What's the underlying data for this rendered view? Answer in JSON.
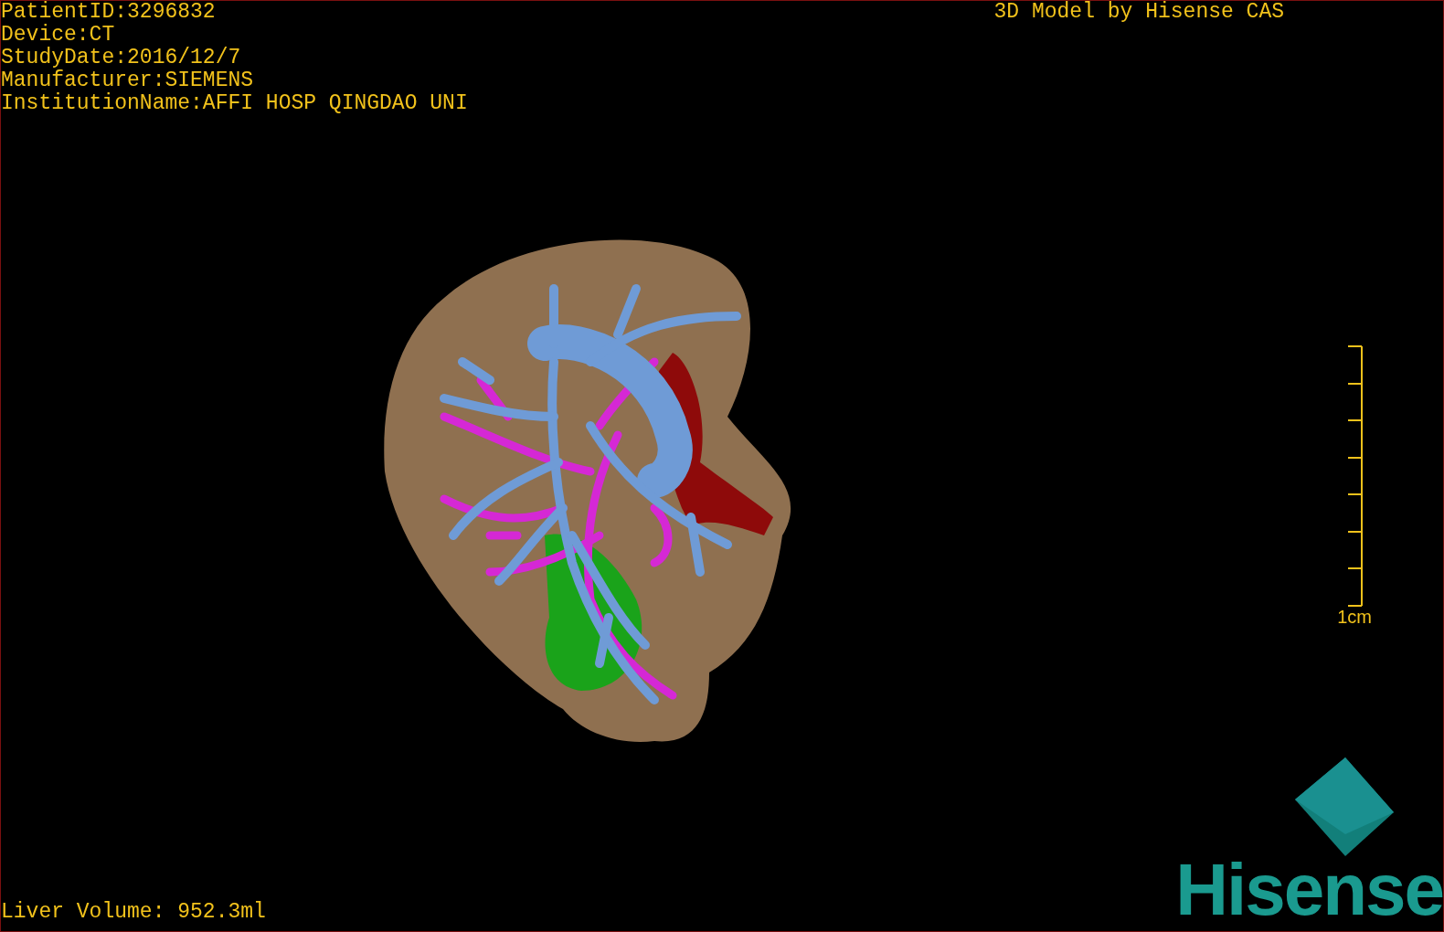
{
  "patient_info": [
    "PatientID:3296832",
    "Device:CT",
    "StudyDate:2016/12/7",
    "Manufacturer:SIEMENS",
    "InstitutionName:AFFI HOSP QINGDAO UNI"
  ],
  "title": "3D Model by Hisense CAS",
  "scale_bar": {
    "label": "1cm"
  },
  "liver_volume": "Liver Volume: 952.3ml",
  "logo": {
    "text": "Hisense"
  }
}
